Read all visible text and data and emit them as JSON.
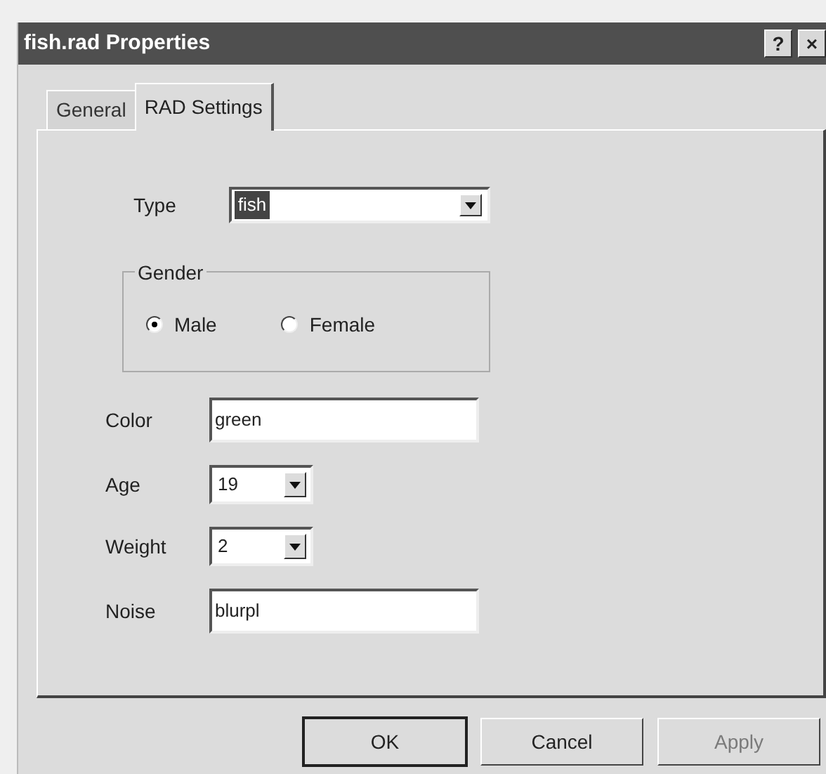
{
  "window": {
    "title": "fish.rad Properties",
    "buttons": [
      {
        "label": "?"
      },
      {
        "label": "×"
      }
    ]
  },
  "tabs": [
    {
      "label": "General",
      "selected": false
    },
    {
      "label": "RAD Settings",
      "selected": true
    }
  ],
  "type": {
    "label": "Type",
    "value": "fish",
    "highlighted": true
  },
  "gender": {
    "label": "Gender",
    "options": [
      {
        "label": "Male",
        "selected": true
      },
      {
        "label": "Female",
        "selected": false
      }
    ]
  },
  "fields": [
    {
      "kind": "text",
      "label": "Color",
      "value": "green"
    },
    {
      "kind": "combo",
      "label": "Age",
      "value": "19"
    },
    {
      "kind": "combo",
      "label": "Weight",
      "value": "2"
    },
    {
      "kind": "text",
      "label": "Noise",
      "value": "blurpl"
    }
  ],
  "buttons": [
    {
      "label": "OK",
      "default": true,
      "disabled": false
    },
    {
      "label": "Cancel",
      "default": false,
      "disabled": false
    },
    {
      "label": "Apply",
      "default": false,
      "disabled": true
    }
  ]
}
